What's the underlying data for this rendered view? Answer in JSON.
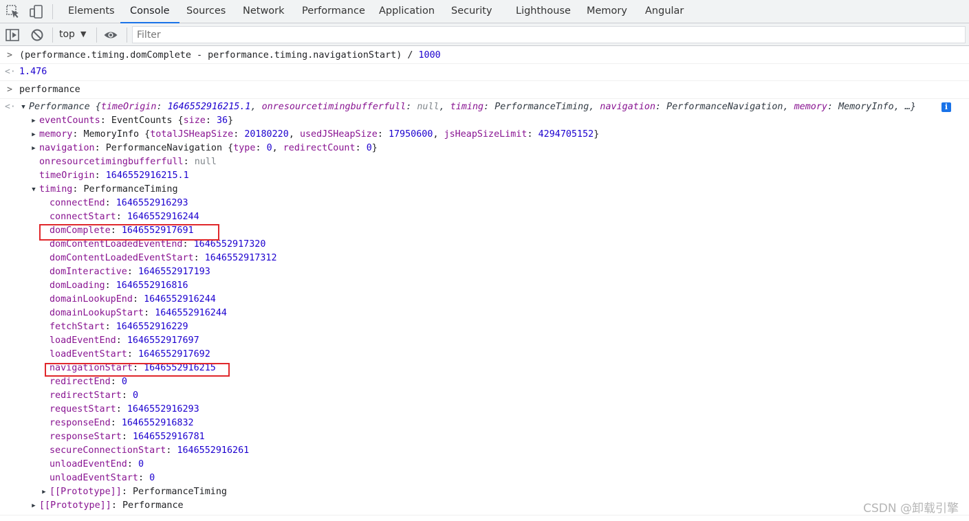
{
  "tabs": [
    {
      "label": "Elements",
      "active": false
    },
    {
      "label": "Console",
      "active": true
    },
    {
      "label": "Sources",
      "active": false
    },
    {
      "label": "Network",
      "active": false
    },
    {
      "label": "Performance",
      "active": false
    },
    {
      "label": "Application",
      "active": false
    },
    {
      "label": "Security",
      "active": false
    },
    {
      "label": "Lighthouse",
      "active": false
    },
    {
      "label": "Memory",
      "active": false
    },
    {
      "label": "Angular",
      "active": false
    }
  ],
  "toolbar": {
    "context": "top",
    "filter_placeholder": "Filter"
  },
  "console": {
    "input1": "(performance.timing.domComplete - performance.timing.navigationStart) / ",
    "input1_number": "1000",
    "output1": "1.476",
    "input2": "performance",
    "perf_summary": {
      "class_name": "Performance",
      "open": " {",
      "k1": "timeOrigin",
      "v1": "1646552916215.1",
      "k2": "onresourcetimingbufferfull",
      "v2": "null",
      "k3": "timing",
      "v3": "PerformanceTiming",
      "k4": "navigation",
      "v4": "PerformanceNavigation",
      "k5": "memory",
      "v5": "MemoryInfo",
      "tail": ", …}"
    },
    "eventCounts": {
      "key": "eventCounts",
      "cls": "EventCounts",
      "open": " {",
      "k": "size",
      "v": "36",
      "close": "}"
    },
    "memory": {
      "key": "memory",
      "cls": "MemoryInfo",
      "open": " {",
      "k1": "totalJSHeapSize",
      "v1": "20180220",
      "k2": "usedJSHeapSize",
      "v2": "17950600",
      "k3": "jsHeapSizeLimit",
      "v3": "4294705152",
      "close": "}"
    },
    "navigation": {
      "key": "navigation",
      "cls": "PerformanceNavigation",
      "open": " {",
      "k1": "type",
      "v1": "0",
      "k2": "redirectCount",
      "v2": "0",
      "close": "}"
    },
    "onresourcetimingbufferfull": {
      "key": "onresourcetimingbufferfull",
      "value": "null"
    },
    "timeOrigin": {
      "key": "timeOrigin",
      "value": "1646552916215.1"
    },
    "timing": {
      "key": "timing",
      "cls": "PerformanceTiming"
    },
    "timing_props": [
      {
        "key": "connectEnd",
        "value": "1646552916293"
      },
      {
        "key": "connectStart",
        "value": "1646552916244"
      },
      {
        "key": "domComplete",
        "value": "1646552917691"
      },
      {
        "key": "domContentLoadedEventEnd",
        "value": "1646552917320"
      },
      {
        "key": "domContentLoadedEventStart",
        "value": "1646552917312"
      },
      {
        "key": "domInteractive",
        "value": "1646552917193"
      },
      {
        "key": "domLoading",
        "value": "1646552916816"
      },
      {
        "key": "domainLookupEnd",
        "value": "1646552916244"
      },
      {
        "key": "domainLookupStart",
        "value": "1646552916244"
      },
      {
        "key": "fetchStart",
        "value": "1646552916229"
      },
      {
        "key": "loadEventEnd",
        "value": "1646552917697"
      },
      {
        "key": "loadEventStart",
        "value": "1646552917692"
      },
      {
        "key": "navigationStart",
        "value": "1646552916215"
      },
      {
        "key": "redirectEnd",
        "value": "0"
      },
      {
        "key": "redirectStart",
        "value": "0"
      },
      {
        "key": "requestStart",
        "value": "1646552916293"
      },
      {
        "key": "responseEnd",
        "value": "1646552916832"
      },
      {
        "key": "responseStart",
        "value": "1646552916781"
      },
      {
        "key": "secureConnectionStart",
        "value": "1646552916261"
      },
      {
        "key": "unloadEventEnd",
        "value": "0"
      },
      {
        "key": "unloadEventStart",
        "value": "0"
      }
    ],
    "timing_proto": {
      "key": "[[Prototype]]",
      "value": "PerformanceTiming"
    },
    "perf_proto": {
      "key": "[[Prototype]]",
      "value": "Performance"
    }
  },
  "watermark": "CSDN @卸载引擎",
  "colors": {
    "accent": "#1a73e8",
    "key": "#881391",
    "number": "#1c00cf",
    "highlight_box": "#e0272b"
  }
}
